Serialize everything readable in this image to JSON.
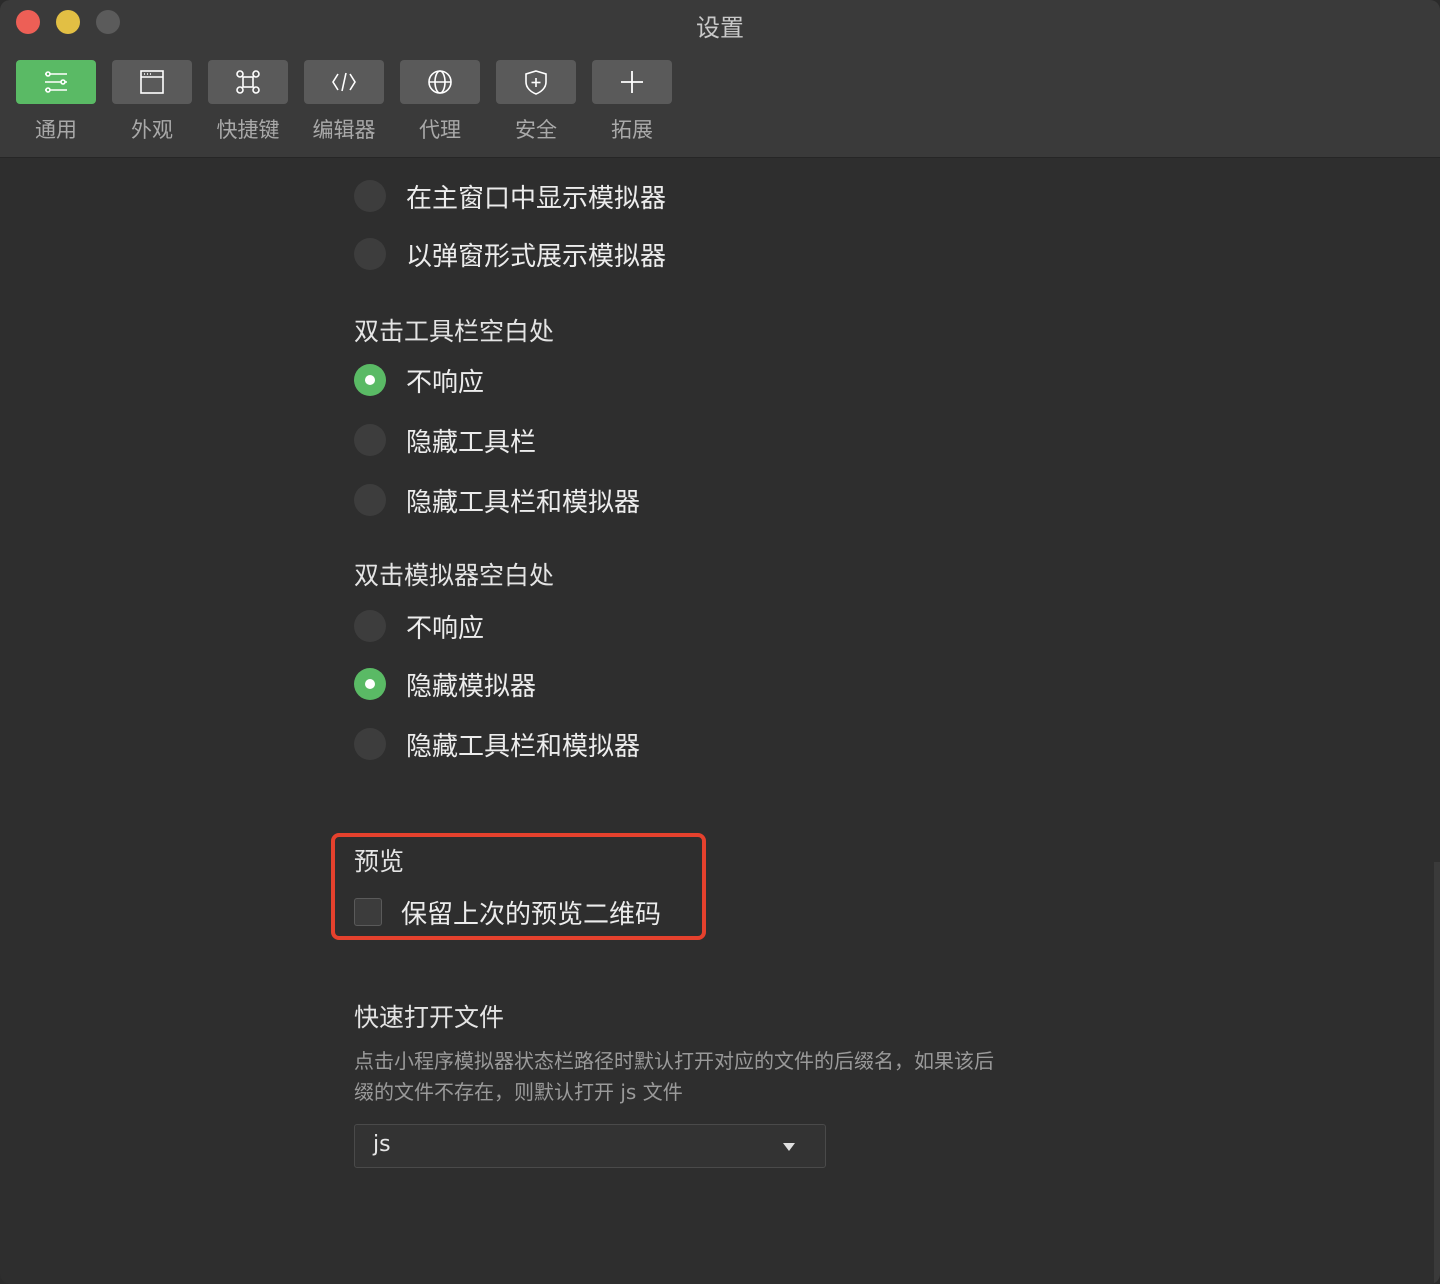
{
  "window": {
    "title": "设置"
  },
  "toolbar": {
    "tabs": [
      {
        "label": "通用",
        "icon": "sliders-icon",
        "active": true
      },
      {
        "label": "外观",
        "icon": "window-icon",
        "active": false
      },
      {
        "label": "快捷键",
        "icon": "command-key-icon",
        "active": false
      },
      {
        "label": "编辑器",
        "icon": "code-icon",
        "active": false
      },
      {
        "label": "代理",
        "icon": "globe-icon",
        "active": false
      },
      {
        "label": "安全",
        "icon": "shield-icon",
        "active": false
      },
      {
        "label": "拓展",
        "icon": "plus-icon",
        "active": false
      }
    ]
  },
  "simulator_display": {
    "options": [
      {
        "label": "在主窗口中显示模拟器",
        "checked": false
      },
      {
        "label": "以弹窗形式展示模拟器",
        "checked": false
      }
    ]
  },
  "toolbar_doubleclick": {
    "title": "双击工具栏空白处",
    "options": [
      {
        "label": "不响应",
        "checked": true
      },
      {
        "label": "隐藏工具栏",
        "checked": false
      },
      {
        "label": "隐藏工具栏和模拟器",
        "checked": false
      }
    ]
  },
  "simulator_doubleclick": {
    "title": "双击模拟器空白处",
    "options": [
      {
        "label": "不响应",
        "checked": false
      },
      {
        "label": "隐藏模拟器",
        "checked": true
      },
      {
        "label": "隐藏工具栏和模拟器",
        "checked": false
      }
    ]
  },
  "preview": {
    "title": "预览",
    "checkbox_label": "保留上次的预览二维码",
    "checked": false
  },
  "quick_open": {
    "title": "快速打开文件",
    "description": "点击小程序模拟器状态栏路径时默认打开对应的文件的后缀名，如果该后缀的文件不存在，则默认打开 js 文件",
    "selected": "js"
  },
  "colors": {
    "accent": "#5aba65",
    "highlight_border": "#e5412d",
    "background": "#2e2e2e"
  }
}
